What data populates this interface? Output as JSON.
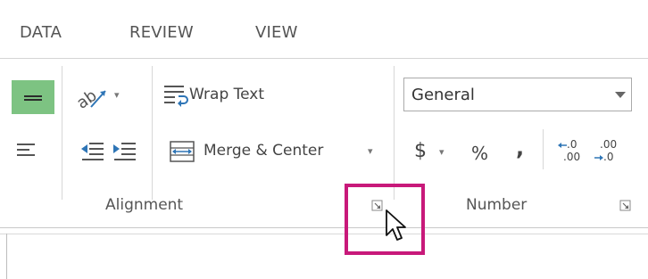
{
  "tabs": [
    {
      "label": "DATA"
    },
    {
      "label": "REVIEW"
    },
    {
      "label": "VIEW"
    }
  ],
  "alignment": {
    "wrap_text_label": "Wrap Text",
    "merge_center_label": "Merge & Center",
    "group_label": "Alignment"
  },
  "number": {
    "format_value": "General",
    "currency_symbol": "$",
    "percent_symbol": "%",
    "comma_symbol": ",",
    "increase_decimal_top": ".0",
    "increase_decimal_bottom": ".00",
    "decrease_decimal_top": ".00",
    "decrease_decimal_bottom": ".0",
    "group_label": "Number"
  },
  "colors": {
    "active_fill": "#7dc382",
    "highlight": "#c8197a",
    "icon_blue": "#2e75b6"
  },
  "icons": [
    "bottom-align-icon",
    "orientation-icon",
    "align-left-icon",
    "decrease-indent-icon",
    "increase-indent-icon",
    "wrap-text-icon",
    "merge-center-icon",
    "dialog-launcher-icon",
    "mouse-cursor-icon"
  ]
}
